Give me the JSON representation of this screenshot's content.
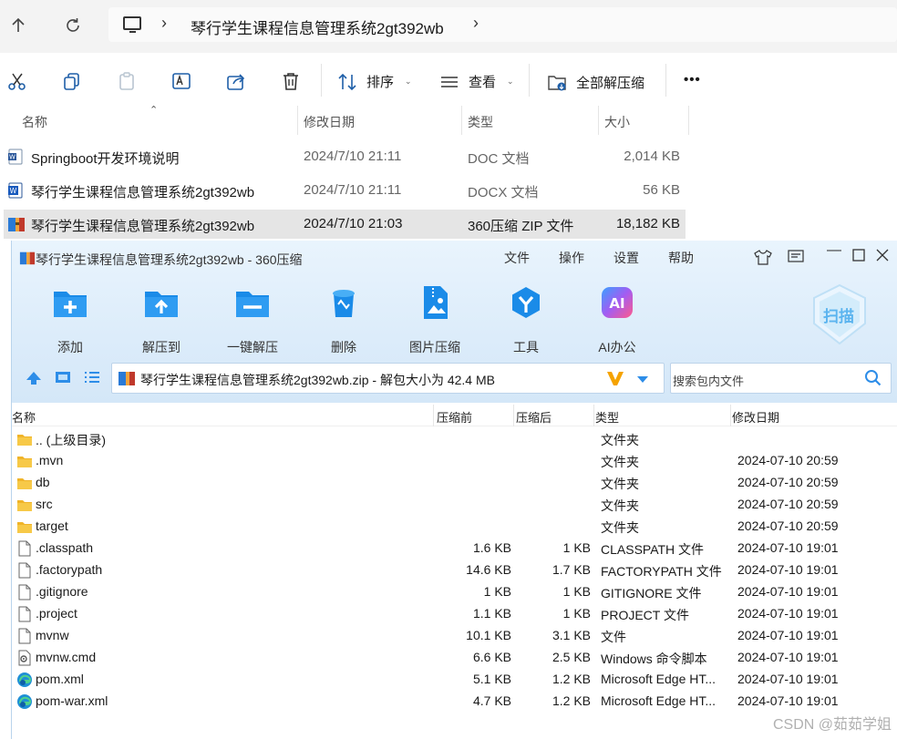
{
  "explorer": {
    "breadcrumb_title": "琴行学生课程信息管理系统2gt392wb",
    "toolbar": {
      "sort_label": "排序",
      "view_label": "查看",
      "extract_all_label": "全部解压缩",
      "more_label": "•••"
    },
    "columns": {
      "name": "名称",
      "modified": "修改日期",
      "type": "类型",
      "size": "大小"
    },
    "files": [
      {
        "name": "Springboot开发环境说明",
        "modified": "2024/7/10 21:11",
        "type": "DOC 文档",
        "size": "2,014 KB",
        "icon": "word-doc-icon",
        "selected": false
      },
      {
        "name": "琴行学生课程信息管理系统2gt392wb",
        "modified": "2024/7/10 21:11",
        "type": "DOCX 文档",
        "size": "56 KB",
        "icon": "word-docx-icon",
        "selected": false
      },
      {
        "name": "琴行学生课程信息管理系统2gt392wb",
        "modified": "2024/7/10 21:03",
        "type": "360压缩 ZIP 文件",
        "size": "18,182 KB",
        "icon": "zip-archive-icon",
        "selected": true
      }
    ]
  },
  "zip_window": {
    "title": "琴行学生课程信息管理系统2gt392wb - 360压缩",
    "menu": [
      "文件",
      "操作",
      "设置",
      "帮助"
    ],
    "toolbar": [
      {
        "label": "添加",
        "icon": "add-folder-icon"
      },
      {
        "label": "解压到",
        "icon": "extract-to-icon"
      },
      {
        "label": "一键解压",
        "icon": "one-click-extract-icon"
      },
      {
        "label": "删除",
        "icon": "delete-bin-icon"
      },
      {
        "label": "图片压缩",
        "icon": "image-compress-icon"
      },
      {
        "label": "工具",
        "icon": "tools-icon"
      },
      {
        "label": "AI办公",
        "icon": "ai-office-icon"
      }
    ],
    "scan_label": "扫描",
    "address_text": "琴行学生课程信息管理系统2gt392wb.zip - 解包大小为 42.4 MB",
    "search_placeholder": "搜索包内文件",
    "columns": {
      "name": "名称",
      "before": "压缩前",
      "after": "压缩后",
      "type": "类型",
      "modified": "修改日期"
    },
    "files": [
      {
        "name": ".. (上级目录)",
        "before": "",
        "after": "",
        "type": "文件夹",
        "modified": "",
        "icon": "folder-icon"
      },
      {
        "name": ".mvn",
        "before": "",
        "after": "",
        "type": "文件夹",
        "modified": "2024-07-10 20:59",
        "icon": "folder-icon"
      },
      {
        "name": "db",
        "before": "",
        "after": "",
        "type": "文件夹",
        "modified": "2024-07-10 20:59",
        "icon": "folder-icon"
      },
      {
        "name": "src",
        "before": "",
        "after": "",
        "type": "文件夹",
        "modified": "2024-07-10 20:59",
        "icon": "folder-icon"
      },
      {
        "name": "target",
        "before": "",
        "after": "",
        "type": "文件夹",
        "modified": "2024-07-10 20:59",
        "icon": "folder-icon"
      },
      {
        "name": ".classpath",
        "before": "1.6 KB",
        "after": "1 KB",
        "type": "CLASSPATH 文件",
        "modified": "2024-07-10 19:01",
        "icon": "file-icon"
      },
      {
        "name": ".factorypath",
        "before": "14.6 KB",
        "after": "1.7 KB",
        "type": "FACTORYPATH 文件",
        "modified": "2024-07-10 19:01",
        "icon": "file-icon"
      },
      {
        "name": ".gitignore",
        "before": "1 KB",
        "after": "1 KB",
        "type": "GITIGNORE 文件",
        "modified": "2024-07-10 19:01",
        "icon": "file-icon"
      },
      {
        "name": ".project",
        "before": "1.1 KB",
        "after": "1 KB",
        "type": "PROJECT 文件",
        "modified": "2024-07-10 19:01",
        "icon": "file-icon"
      },
      {
        "name": "mvnw",
        "before": "10.1 KB",
        "after": "3.1 KB",
        "type": "文件",
        "modified": "2024-07-10 19:01",
        "icon": "file-icon"
      },
      {
        "name": "mvnw.cmd",
        "before": "6.6 KB",
        "after": "2.5 KB",
        "type": "Windows 命令脚本",
        "modified": "2024-07-10 19:01",
        "icon": "cmd-script-icon"
      },
      {
        "name": "pom.xml",
        "before": "5.1 KB",
        "after": "1.2 KB",
        "type": "Microsoft Edge HT...",
        "modified": "2024-07-10 19:01",
        "icon": "edge-icon"
      },
      {
        "name": "pom-war.xml",
        "before": "4.7 KB",
        "after": "1.2 KB",
        "type": "Microsoft Edge HT...",
        "modified": "2024-07-10 19:01",
        "icon": "edge-icon"
      }
    ]
  },
  "watermark": "CSDN @茹茹学姐"
}
